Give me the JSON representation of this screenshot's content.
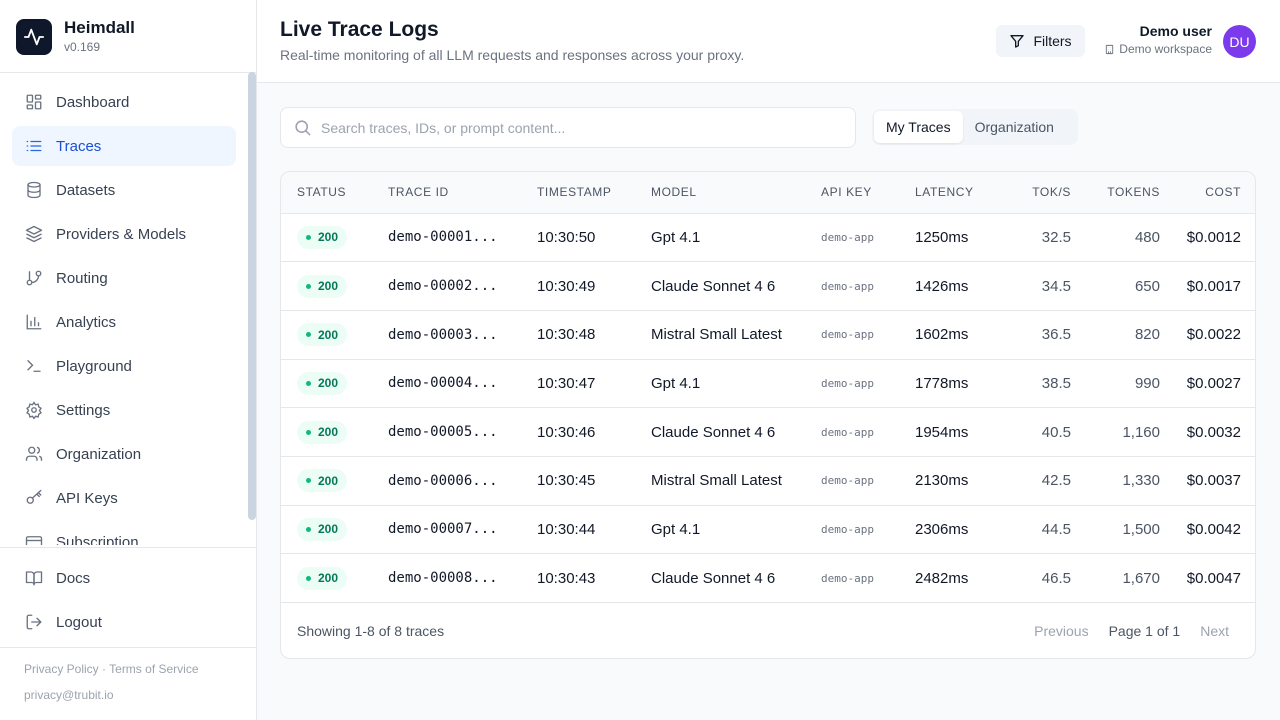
{
  "brand": {
    "name": "Heimdall",
    "version": "v0.169"
  },
  "sidebar": {
    "items": [
      {
        "label": "Dashboard",
        "icon": "dashboard-icon",
        "active": false
      },
      {
        "label": "Traces",
        "icon": "list-icon",
        "active": true
      },
      {
        "label": "Datasets",
        "icon": "database-icon",
        "active": false
      },
      {
        "label": "Providers & Models",
        "icon": "layers-icon",
        "active": false
      },
      {
        "label": "Routing",
        "icon": "git-branch-icon",
        "active": false
      },
      {
        "label": "Analytics",
        "icon": "bar-chart-icon",
        "active": false
      },
      {
        "label": "Playground",
        "icon": "terminal-icon",
        "active": false
      },
      {
        "label": "Settings",
        "icon": "gear-icon",
        "active": false
      },
      {
        "label": "Organization",
        "icon": "users-icon",
        "active": false
      },
      {
        "label": "API Keys",
        "icon": "key-icon",
        "active": false
      },
      {
        "label": "Subscription",
        "icon": "credit-card-icon",
        "active": false
      }
    ],
    "bottom": [
      {
        "label": "Docs",
        "icon": "book-icon"
      },
      {
        "label": "Logout",
        "icon": "logout-icon"
      }
    ],
    "legal": {
      "privacy": "Privacy Policy",
      "sep": " · ",
      "terms": "Terms of Service",
      "email": "privacy@trubit.io"
    }
  },
  "header": {
    "title": "Live Trace Logs",
    "subtitle": "Real-time monitoring of all LLM requests and responses across your proxy.",
    "filters_label": "Filters",
    "user_name": "Demo user",
    "workspace": "Demo workspace",
    "avatar_initials": "DU"
  },
  "search": {
    "placeholder": "Search traces, IDs, or prompt content..."
  },
  "scope_tabs": [
    {
      "label": "My Traces",
      "active": true
    },
    {
      "label": "Organization",
      "active": false
    }
  ],
  "table": {
    "columns": [
      "STATUS",
      "TRACE ID",
      "TIMESTAMP",
      "MODEL",
      "API KEY",
      "LATENCY",
      "TOK/S",
      "TOKENS",
      "COST"
    ],
    "rows": [
      {
        "status": "200",
        "trace_id": "demo-00001...",
        "timestamp": "10:30:50",
        "model": "Gpt 4.1",
        "api_key": "demo-app",
        "latency": "1250ms",
        "tok_s": "32.5",
        "tokens": "480",
        "cost": "$0.0012"
      },
      {
        "status": "200",
        "trace_id": "demo-00002...",
        "timestamp": "10:30:49",
        "model": "Claude Sonnet 4 6",
        "api_key": "demo-app",
        "latency": "1426ms",
        "tok_s": "34.5",
        "tokens": "650",
        "cost": "$0.0017"
      },
      {
        "status": "200",
        "trace_id": "demo-00003...",
        "timestamp": "10:30:48",
        "model": "Mistral Small Latest",
        "api_key": "demo-app",
        "latency": "1602ms",
        "tok_s": "36.5",
        "tokens": "820",
        "cost": "$0.0022"
      },
      {
        "status": "200",
        "trace_id": "demo-00004...",
        "timestamp": "10:30:47",
        "model": "Gpt 4.1",
        "api_key": "demo-app",
        "latency": "1778ms",
        "tok_s": "38.5",
        "tokens": "990",
        "cost": "$0.0027"
      },
      {
        "status": "200",
        "trace_id": "demo-00005...",
        "timestamp": "10:30:46",
        "model": "Claude Sonnet 4 6",
        "api_key": "demo-app",
        "latency": "1954ms",
        "tok_s": "40.5",
        "tokens": "1,160",
        "cost": "$0.0032"
      },
      {
        "status": "200",
        "trace_id": "demo-00006...",
        "timestamp": "10:30:45",
        "model": "Mistral Small Latest",
        "api_key": "demo-app",
        "latency": "2130ms",
        "tok_s": "42.5",
        "tokens": "1,330",
        "cost": "$0.0037"
      },
      {
        "status": "200",
        "trace_id": "demo-00007...",
        "timestamp": "10:30:44",
        "model": "Gpt 4.1",
        "api_key": "demo-app",
        "latency": "2306ms",
        "tok_s": "44.5",
        "tokens": "1,500",
        "cost": "$0.0042"
      },
      {
        "status": "200",
        "trace_id": "demo-00008...",
        "timestamp": "10:30:43",
        "model": "Claude Sonnet 4 6",
        "api_key": "demo-app",
        "latency": "2482ms",
        "tok_s": "46.5",
        "tokens": "1,670",
        "cost": "$0.0047"
      }
    ]
  },
  "pagination": {
    "summary": "Showing 1-8 of 8 traces",
    "previous": "Previous",
    "page_info": "Page 1 of 1",
    "next": "Next"
  },
  "colors": {
    "accent": "#2563eb",
    "active_bg": "#eff6ff",
    "success": "#10b981",
    "avatar": "#7c3aed"
  }
}
